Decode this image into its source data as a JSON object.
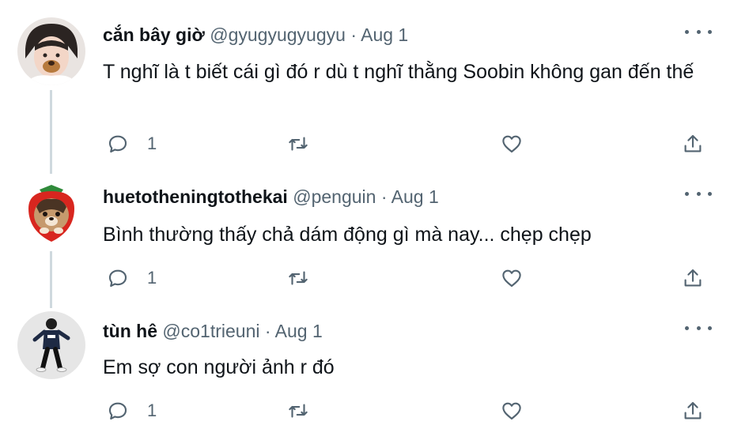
{
  "tweets": [
    {
      "name": "cắn bây giờ",
      "handle": "@gyugyugyugyu",
      "separator": "·",
      "date": "Aug 1",
      "text": "T nghĩ là t biết cái gì đó r dù t nghĩ thằng Soobin không gan đến thế",
      "reply_count": "1"
    },
    {
      "name": "huetotheningtothekai",
      "handle": "@penguin",
      "separator": "·",
      "date": "Aug 1",
      "text": "Bình thường thấy chả dám động gì mà nay... chẹp chẹp",
      "reply_count": "1"
    },
    {
      "name": "tùn hê",
      "handle": "@co1trieuni",
      "separator": "·",
      "date": "Aug 1",
      "text": "Em sợ con người ảnh r đó",
      "reply_count": "1"
    }
  ],
  "colors": {
    "text": "#0f1419",
    "secondary": "#536471",
    "thread_line": "#cfd9de"
  },
  "icons": [
    "reply-icon",
    "retweet-icon",
    "like-icon",
    "share-icon",
    "more-icon"
  ]
}
